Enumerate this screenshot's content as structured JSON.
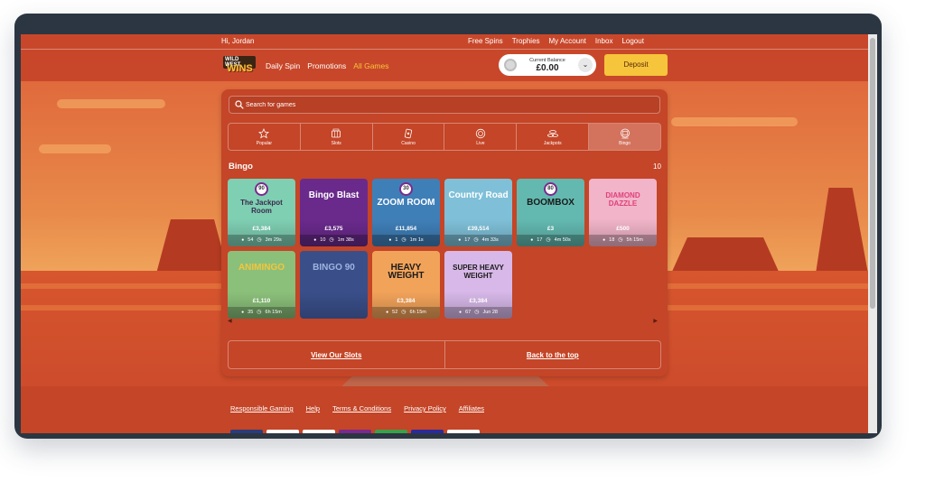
{
  "topbar": {
    "greeting": "Hi, Jordan",
    "links": [
      "Free Spins",
      "Trophies",
      "My Account",
      "Inbox",
      "Logout"
    ]
  },
  "brand": {
    "logo_top": "WILD WEST",
    "logo_bottom": "WINS"
  },
  "nav": {
    "links": [
      {
        "label": "Daily Spin",
        "active": false
      },
      {
        "label": "Promotions",
        "active": false
      },
      {
        "label": "All Games",
        "active": true
      }
    ]
  },
  "balance": {
    "label": "Current Balance",
    "amount": "£0.00"
  },
  "deposit_label": "Deposit",
  "search": {
    "placeholder": "Search for games"
  },
  "categories": [
    {
      "label": "Popular",
      "icon": "star-icon"
    },
    {
      "label": "Slots",
      "icon": "slot-machine-icon"
    },
    {
      "label": "Casino",
      "icon": "cards-icon"
    },
    {
      "label": "Live",
      "icon": "chip-icon"
    },
    {
      "label": "Jackpots",
      "icon": "coins-icon"
    },
    {
      "label": "Bingo",
      "icon": "bingo-icon",
      "active": true
    }
  ],
  "section": {
    "title": "Bingo",
    "count": "10"
  },
  "games": [
    {
      "title": "The Jackpot Room",
      "badge": "90",
      "jackpot": "£3,384",
      "players": "54",
      "time": "3m 29s",
      "bg": "#7fcfb3",
      "fg": "#3a2a4a"
    },
    {
      "title": "Bingo Blast",
      "badge": "",
      "jackpot": "£3,575",
      "players": "10",
      "time": "1m 38s",
      "bg": "#6a2a8c",
      "fg": "#ffffff"
    },
    {
      "title": "ZOOM ROOM",
      "badge": "30",
      "jackpot": "£11,854",
      "players": "1",
      "time": "1m 1s",
      "bg": "#3f7fb8",
      "fg": "#ffffff"
    },
    {
      "title": "Country Road",
      "badge": "",
      "jackpot": "£39,514",
      "players": "17",
      "time": "4m 33s",
      "bg": "#7fc0d8",
      "fg": "#ffffff"
    },
    {
      "title": "BOOMBOX",
      "badge": "80",
      "jackpot": "£3",
      "players": "17",
      "time": "4m 50s",
      "bg": "#63b9b0",
      "fg": "#1a1a1a"
    },
    {
      "title": "DIAMOND DAZZLE",
      "badge": "",
      "jackpot": "£500",
      "players": "18",
      "time": "5h 15m",
      "bg": "#f1b4c8",
      "fg": "#e0407a"
    },
    {
      "title": "ANIMINGO",
      "badge": "",
      "jackpot": "£1,110",
      "players": "35",
      "time": "6h 15m",
      "bg": "#8bc07a",
      "fg": "#f6c53b"
    },
    {
      "title": "BINGO 90",
      "badge": "",
      "jackpot": "",
      "players": "",
      "time": "",
      "bg": "#3a4f8a",
      "fg": "#9fb4e0"
    },
    {
      "title": "HEAVY WEIGHT",
      "badge": "",
      "jackpot": "£3,384",
      "players": "52",
      "time": "6h 15m",
      "bg": "#f2a35a",
      "fg": "#1a1a1a"
    },
    {
      "title": "SUPER HEAVY WEIGHT",
      "badge": "",
      "jackpot": "£3,384",
      "players": "67",
      "time": "Jun 28",
      "bg": "#d7b8e8",
      "fg": "#1a1a1a"
    }
  ],
  "panel_buttons": {
    "left": "View Our Slots",
    "right": "Back to the top"
  },
  "footer": {
    "links": [
      "Responsible Gaming",
      "Help",
      "Terms & Conditions",
      "Privacy Policy",
      "Affiliates"
    ]
  }
}
